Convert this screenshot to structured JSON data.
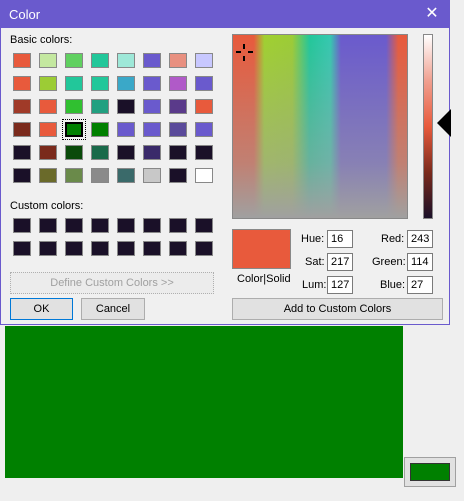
{
  "dialog": {
    "title": "Color",
    "basic_colors_label": "Basic colors:",
    "custom_colors_label": "Custom colors:",
    "define_button": "Define Custom Colors >>",
    "ok_button": "OK",
    "cancel_button": "Cancel",
    "color_solid_label": "Color|Solid",
    "add_button": "Add to Custom Colors",
    "hue_label": "Hue:",
    "sat_label": "Sat:",
    "lum_label": "Lum:",
    "red_label": "Red:",
    "green_label": "Green:",
    "blue_label": "Blue:",
    "hue": "16",
    "sat": "217",
    "lum": "127",
    "red": "243",
    "green": "114",
    "blue": "27"
  },
  "colors": {
    "accent": "#6a5acd",
    "selected_color": "#e85a3c",
    "canvas_fill": "#008000"
  },
  "basic_colors": [
    [
      "#e85a3c",
      "#c4e8a0",
      "#60d060",
      "#22c79a",
      "#9ee8d8",
      "#6a5acd",
      "#e89080",
      "#c8c8ff"
    ],
    [
      "#e85a3c",
      "#9ccc35",
      "#22c79a",
      "#22c79a",
      "#3aa8c8",
      "#6a5acd",
      "#b05ac8",
      "#6a5acd"
    ],
    [
      "#a03a28",
      "#e85a3c",
      "#30c030",
      "#22a080",
      "#1a1028",
      "#6a5acd",
      "#5a3a8a",
      "#e85a3c"
    ],
    [
      "#7a2a1c",
      "#e85a3c",
      "#008000",
      "#008000",
      "#6a5acd",
      "#6a5acd",
      "#5a4a9a",
      "#6a5acd"
    ],
    [
      "#1a1028",
      "#7a2a1c",
      "#0a4a0a",
      "#1a6a4a",
      "#1a1028",
      "#3a2a6a",
      "#1a1028",
      "#1a1028"
    ],
    [
      "#1a1028",
      "#6a6a2a",
      "#6a8a4a",
      "#8a8a8a",
      "#3a6a6a",
      "#c8c8c8",
      "#1a1028",
      "#ffffff"
    ]
  ],
  "custom_colors": [
    [
      "#1a1028",
      "#1a1028",
      "#1a1028",
      "#1a1028",
      "#1a1028",
      "#1a1028",
      "#1a1028",
      "#1a1028"
    ],
    [
      "#1a1028",
      "#1a1028",
      "#1a1028",
      "#1a1028",
      "#1a1028",
      "#1a1028",
      "#1a1028",
      "#1a1028"
    ]
  ]
}
